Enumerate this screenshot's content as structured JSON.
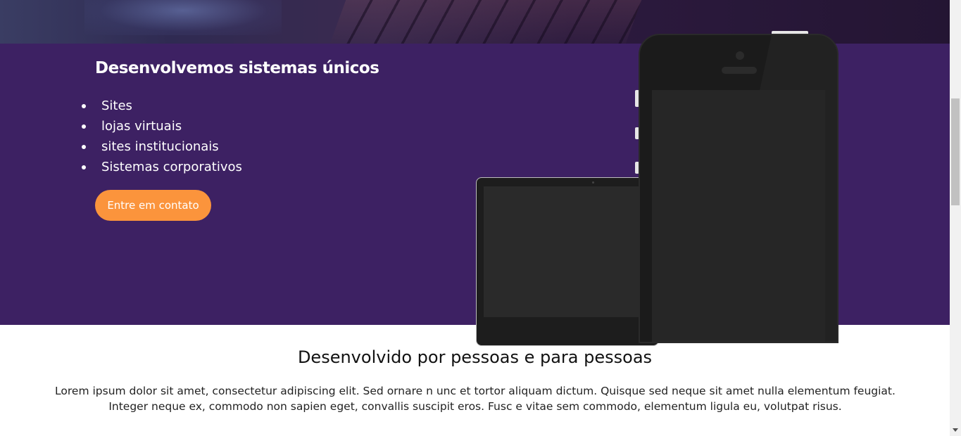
{
  "hero": {
    "title": "Desenvolvemos sistemas únicos",
    "features": [
      "Sites",
      "lojas virtuais",
      "sites institucionais",
      "Sistemas corporativos"
    ],
    "cta_label": "Entre em contato",
    "colors": {
      "band": "#3d2163",
      "cta": "#fb943c"
    }
  },
  "about": {
    "title": "Desenvolvido por pessoas e para pessoas",
    "text": "Lorem ipsum dolor sit amet, consectetur adipiscing elit. Sed ornare n unc et tortor aliquam dictum. Quisque sed neque sit amet nulla elementum feugiat. Integer neque ex, commodo non sapien eget, convallis suscipit eros. Fusc e vitae sem commodo, elementum ligula eu, volutpat risus."
  }
}
